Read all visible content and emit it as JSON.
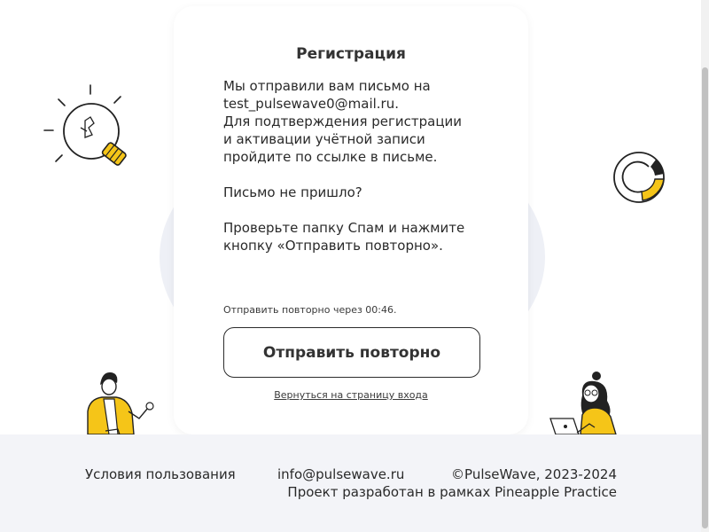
{
  "card": {
    "title": "Регистрация",
    "message_lines": [
      "Мы отправили вам письмо на",
      "test_pulsewave0@mail.ru.",
      "Для подтверждения регистрации",
      "и активации учётной записи",
      "пройдите по ссылке в письме."
    ],
    "not_received": "Письмо не пришло?",
    "spam_lines": [
      "Проверьте папку Спам и нажмите",
      "кнопку «Отправить повторно»."
    ],
    "timer_text": "Отправить повторно через 00:46.",
    "resend_button_label": "Отправить повторно",
    "back_link_label": "Вернуться на страницу входа"
  },
  "footer": {
    "terms_link": "Условия пользования",
    "email_link": "info@pulsewave.ru",
    "copyright": "©PulseWave, 2023-2024",
    "project_note": "Проект разработан в рамках Pineapple Practice"
  },
  "colors": {
    "accent_yellow": "#f5c518",
    "footer_bg": "#f3f4f8",
    "blob_bg": "#eef0f6",
    "text": "#2c2c2c"
  },
  "icons": [
    "lightbulb-icon",
    "loading-ring-icon",
    "man-illustration",
    "woman-laptop-illustration"
  ]
}
